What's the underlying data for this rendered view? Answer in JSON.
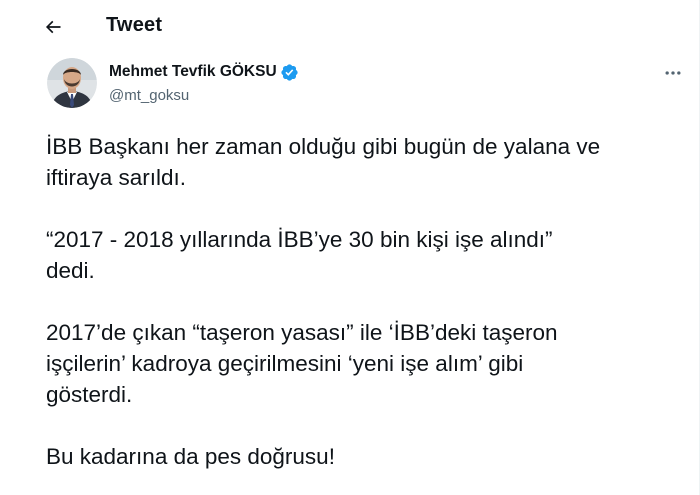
{
  "header": {
    "title": "Tweet",
    "back_icon": "arrow-left-icon"
  },
  "author": {
    "display_name": "Mehmet Tevfik GÖKSU",
    "handle": "@mt_goksu",
    "verified": true,
    "verified_icon": "verified-badge-icon",
    "more_icon": "more-horizontal-icon"
  },
  "tweet": {
    "paragraphs": [
      "İBB Başkanı her zaman olduğu gibi bugün de yalana ve\niftiraya sarıldı.",
      "“2017 - 2018 yıllarında İBB’ye 30 bin kişi işe alındı”\ndedi.",
      "2017’de çıkan “taşeron yasası” ile ‘İBB’deki taşeron\nişçilerin’ kadroya geçirilmesini ‘yeni işe alım’ gibi\ngösterdi.",
      "Bu kadarına da pes doğrusu!"
    ]
  },
  "colors": {
    "text": "#0f1419",
    "secondary": "#536471",
    "verified": "#1d9bf0"
  }
}
